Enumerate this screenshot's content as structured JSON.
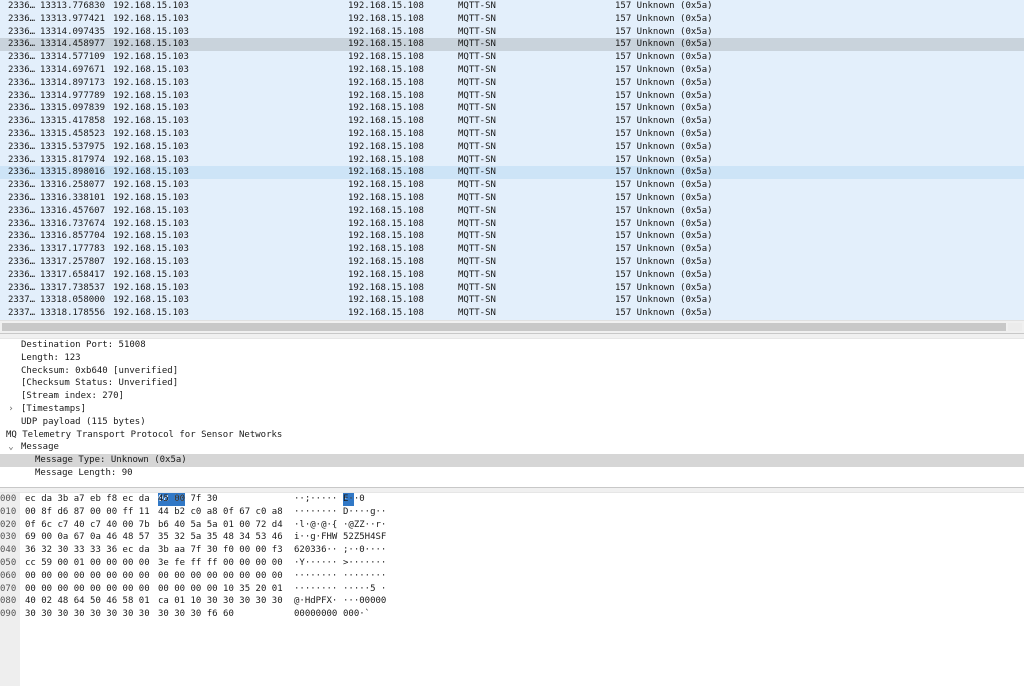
{
  "packet_list": {
    "rows": [
      {
        "no": "2336…",
        "time": "13313.776830",
        "source": "192.168.15.103",
        "destination": "192.168.15.108",
        "protocol": "MQTT-SN",
        "info": "157 Unknown (0x5a)"
      },
      {
        "no": "2336…",
        "time": "13313.977421",
        "source": "192.168.15.103",
        "destination": "192.168.15.108",
        "protocol": "MQTT-SN",
        "info": "157 Unknown (0x5a)"
      },
      {
        "no": "2336…",
        "time": "13314.097435",
        "source": "192.168.15.103",
        "destination": "192.168.15.108",
        "protocol": "MQTT-SN",
        "info": "157 Unknown (0x5a)"
      },
      {
        "no": "2336…",
        "time": "13314.458977",
        "source": "192.168.15.103",
        "destination": "192.168.15.108",
        "protocol": "MQTT-SN",
        "info": "157 Unknown (0x5a)"
      },
      {
        "no": "2336…",
        "time": "13314.577109",
        "source": "192.168.15.103",
        "destination": "192.168.15.108",
        "protocol": "MQTT-SN",
        "info": "157 Unknown (0x5a)"
      },
      {
        "no": "2336…",
        "time": "13314.697671",
        "source": "192.168.15.103",
        "destination": "192.168.15.108",
        "protocol": "MQTT-SN",
        "info": "157 Unknown (0x5a)"
      },
      {
        "no": "2336…",
        "time": "13314.897173",
        "source": "192.168.15.103",
        "destination": "192.168.15.108",
        "protocol": "MQTT-SN",
        "info": "157 Unknown (0x5a)"
      },
      {
        "no": "2336…",
        "time": "13314.977789",
        "source": "192.168.15.103",
        "destination": "192.168.15.108",
        "protocol": "MQTT-SN",
        "info": "157 Unknown (0x5a)"
      },
      {
        "no": "2336…",
        "time": "13315.097839",
        "source": "192.168.15.103",
        "destination": "192.168.15.108",
        "protocol": "MQTT-SN",
        "info": "157 Unknown (0x5a)"
      },
      {
        "no": "2336…",
        "time": "13315.417858",
        "source": "192.168.15.103",
        "destination": "192.168.15.108",
        "protocol": "MQTT-SN",
        "info": "157 Unknown (0x5a)"
      },
      {
        "no": "2336…",
        "time": "13315.458523",
        "source": "192.168.15.103",
        "destination": "192.168.15.108",
        "protocol": "MQTT-SN",
        "info": "157 Unknown (0x5a)"
      },
      {
        "no": "2336…",
        "time": "13315.537975",
        "source": "192.168.15.103",
        "destination": "192.168.15.108",
        "protocol": "MQTT-SN",
        "info": "157 Unknown (0x5a)"
      },
      {
        "no": "2336…",
        "time": "13315.817974",
        "source": "192.168.15.103",
        "destination": "192.168.15.108",
        "protocol": "MQTT-SN",
        "info": "157 Unknown (0x5a)"
      },
      {
        "no": "2336…",
        "time": "13315.898016",
        "source": "192.168.15.103",
        "destination": "192.168.15.108",
        "protocol": "MQTT-SN",
        "info": "157 Unknown (0x5a)"
      },
      {
        "no": "2336…",
        "time": "13316.258077",
        "source": "192.168.15.103",
        "destination": "192.168.15.108",
        "protocol": "MQTT-SN",
        "info": "157 Unknown (0x5a)"
      },
      {
        "no": "2336…",
        "time": "13316.338101",
        "source": "192.168.15.103",
        "destination": "192.168.15.108",
        "protocol": "MQTT-SN",
        "info": "157 Unknown (0x5a)"
      },
      {
        "no": "2336…",
        "time": "13316.457607",
        "source": "192.168.15.103",
        "destination": "192.168.15.108",
        "protocol": "MQTT-SN",
        "info": "157 Unknown (0x5a)"
      },
      {
        "no": "2336…",
        "time": "13316.737674",
        "source": "192.168.15.103",
        "destination": "192.168.15.108",
        "protocol": "MQTT-SN",
        "info": "157 Unknown (0x5a)"
      },
      {
        "no": "2336…",
        "time": "13316.857704",
        "source": "192.168.15.103",
        "destination": "192.168.15.108",
        "protocol": "MQTT-SN",
        "info": "157 Unknown (0x5a)"
      },
      {
        "no": "2336…",
        "time": "13317.177783",
        "source": "192.168.15.103",
        "destination": "192.168.15.108",
        "protocol": "MQTT-SN",
        "info": "157 Unknown (0x5a)"
      },
      {
        "no": "2336…",
        "time": "13317.257807",
        "source": "192.168.15.103",
        "destination": "192.168.15.108",
        "protocol": "MQTT-SN",
        "info": "157 Unknown (0x5a)"
      },
      {
        "no": "2336…",
        "time": "13317.658417",
        "source": "192.168.15.103",
        "destination": "192.168.15.108",
        "protocol": "MQTT-SN",
        "info": "157 Unknown (0x5a)"
      },
      {
        "no": "2336…",
        "time": "13317.738537",
        "source": "192.168.15.103",
        "destination": "192.168.15.108",
        "protocol": "MQTT-SN",
        "info": "157 Unknown (0x5a)"
      },
      {
        "no": "2337…",
        "time": "13318.058000",
        "source": "192.168.15.103",
        "destination": "192.168.15.108",
        "protocol": "MQTT-SN",
        "info": "157 Unknown (0x5a)"
      },
      {
        "no": "2337…",
        "time": "13318.178556",
        "source": "192.168.15.103",
        "destination": "192.168.15.108",
        "protocol": "MQTT-SN",
        "info": "157 Unknown (0x5a)"
      }
    ],
    "colors": {
      "row_bg": "#e3effb",
      "row_selected": "#c9d3dc",
      "row_highlight": "#cde4f7"
    }
  },
  "details": {
    "rows": [
      {
        "text": "Destination Port: 51008",
        "expander": "",
        "selected": false,
        "level": 1
      },
      {
        "text": "Length: 123",
        "expander": "",
        "selected": false,
        "level": 1
      },
      {
        "text": "Checksum: 0xb640 [unverified]",
        "expander": "",
        "selected": false,
        "level": 1
      },
      {
        "text": "[Checksum Status: Unverified]",
        "expander": "",
        "selected": false,
        "level": 1
      },
      {
        "text": "[Stream index: 270]",
        "expander": "",
        "selected": false,
        "level": 1
      },
      {
        "text": "[Timestamps]",
        "expander": "›",
        "selected": false,
        "level": 1
      },
      {
        "text": "UDP payload (115 bytes)",
        "expander": "",
        "selected": false,
        "level": 1
      },
      {
        "text": "MQ Telemetry Transport Protocol for Sensor Networks",
        "expander": "",
        "selected": false,
        "level": 0
      },
      {
        "text": "Message",
        "expander": "⌄",
        "selected": false,
        "level": 1
      },
      {
        "text": "Message Type: Unknown (0x5a)",
        "expander": "",
        "selected": true,
        "level": 2
      },
      {
        "text": "Message Length: 90",
        "expander": "",
        "selected": false,
        "level": 2
      }
    ]
  },
  "bytes": {
    "rows": [
      {
        "offset": "000",
        "hex1": "ec da 3b a7 eb f8 ec da",
        "hex2": "3b aa 7f 30",
        "hex2_hl": "08 00",
        "hex2_tail": "45 00",
        "ascii1": "··;·····",
        "ascii2": "; ·0",
        "ascii2_hl": "··",
        "ascii2_tail": "E·"
      },
      {
        "offset": "010",
        "hex1": "00 8f d6 87 00 00 ff 11",
        "hex2": "44 b2 c0 a8 0f 67 c0 a8",
        "hex2_hl": "",
        "hex2_tail": "",
        "ascii1": "········",
        "ascii2": "D····g··",
        "ascii2_hl": "",
        "ascii2_tail": ""
      },
      {
        "offset": "020",
        "hex1": "0f 6c c7 40 c7 40 00 7b",
        "hex2": "b6 40 5a 5a 01 00 72 d4",
        "hex2_hl": "",
        "hex2_tail": "",
        "ascii1": "·l·@·@·{",
        "ascii2": "·@ZZ··r·",
        "ascii2_hl": "",
        "ascii2_tail": ""
      },
      {
        "offset": "030",
        "hex1": "69 00 0a 67 0a 46 48 57",
        "hex2": "35 32 5a 35 48 34 53 46",
        "hex2_hl": "",
        "hex2_tail": "",
        "ascii1": "i··g·FHW",
        "ascii2": "52Z5H4SF",
        "ascii2_hl": "",
        "ascii2_tail": ""
      },
      {
        "offset": "040",
        "hex1": "36 32 30 33 33 36 ec da",
        "hex2": "3b aa 7f 30 f0 00 00 f3",
        "hex2_hl": "",
        "hex2_tail": "",
        "ascii1": "620336··",
        "ascii2": ";··0····",
        "ascii2_hl": "",
        "ascii2_tail": ""
      },
      {
        "offset": "050",
        "hex1": "cc 59 00 01 00 00 00 00",
        "hex2": "3e fe ff ff 00 00 00 00",
        "hex2_hl": "",
        "hex2_tail": "",
        "ascii1": "·Y······",
        "ascii2": ">·······",
        "ascii2_hl": "",
        "ascii2_tail": ""
      },
      {
        "offset": "060",
        "hex1": "00 00 00 00 00 00 00 00",
        "hex2": "00 00 00 00 00 00 00 00",
        "hex2_hl": "",
        "hex2_tail": "",
        "ascii1": "········",
        "ascii2": "········",
        "ascii2_hl": "",
        "ascii2_tail": ""
      },
      {
        "offset": "070",
        "hex1": "00 00 00 00 00 00 00 00",
        "hex2": "00 00 00 00 10 35 20 01",
        "hex2_hl": "",
        "hex2_tail": "",
        "ascii1": "········",
        "ascii2": "·····5 ·",
        "ascii2_hl": "",
        "ascii2_tail": ""
      },
      {
        "offset": "080",
        "hex1": "40 02 48 64 50 46 58 01",
        "hex2": "ca 01 10 30 30 30 30 30",
        "hex2_hl": "",
        "hex2_tail": "",
        "ascii1": "@·HdPFX·",
        "ascii2": "···00000",
        "ascii2_hl": "",
        "ascii2_tail": ""
      },
      {
        "offset": "090",
        "hex1": "30 30 30 30 30 30 30 30",
        "hex2": "30 30 30 f6 60",
        "hex2_hl": "",
        "hex2_tail": "",
        "ascii1": "00000000",
        "ascii2": "000·`",
        "ascii2_hl": "",
        "ascii2_tail": ""
      }
    ],
    "colors": {
      "highlight": "#3178c6"
    }
  }
}
